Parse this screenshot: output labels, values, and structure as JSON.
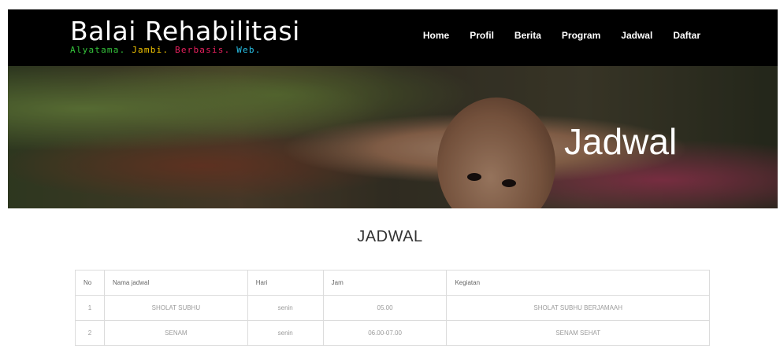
{
  "brand": {
    "title": "Balai Rehabilitasi",
    "tagline": [
      {
        "text": "Alyatama.",
        "color": "#35c43b"
      },
      {
        "text": "Jambi.",
        "color": "#f2c400"
      },
      {
        "text": "Berbasis.",
        "color": "#e8205e"
      },
      {
        "text": "Web.",
        "color": "#29c3ea"
      }
    ]
  },
  "nav": {
    "items": [
      "Home",
      "Profil",
      "Berita",
      "Program",
      "Jadwal",
      "Daftar"
    ]
  },
  "hero": {
    "title": "Jadwal"
  },
  "section": {
    "title": "JADWAL"
  },
  "table": {
    "headers": [
      "No",
      "Nama jadwal",
      "Hari",
      "Jam",
      "Kegiatan"
    ],
    "rows": [
      [
        "1",
        "SHOLAT SUBHU",
        "senin",
        "05.00",
        "SHOLAT SUBHU BERJAMAAH"
      ],
      [
        "2",
        "SENAM",
        "senin",
        "06.00-07.00",
        "SENAM SEHAT"
      ]
    ]
  }
}
